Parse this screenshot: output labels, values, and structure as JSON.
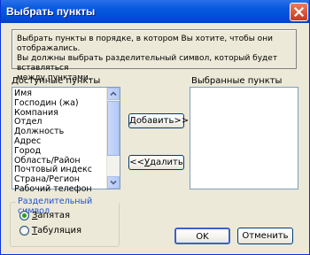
{
  "window": {
    "title": "Выбрать пункты"
  },
  "info": {
    "line1": "Выбрать пункты в порядке, в котором Вы хотите, чтобы они отображались.",
    "line2": "Вы должны выбрать разделительный символ, который будет вставляться",
    "line3": "между пунктами."
  },
  "available": {
    "label_first": "Д",
    "label_rest": "оступные пункты",
    "items": [
      "Имя",
      "Господин (жа)",
      "Компания",
      "Отдел",
      "Должность",
      "Адрес",
      "Город",
      "Область/Район",
      "Почтовый индекс",
      "Страна/Регион",
      "Рабочий телефон"
    ]
  },
  "selected": {
    "label": "Выбранные пункты",
    "items": []
  },
  "buttons": {
    "add_first": "Д",
    "add_rest": "обавить>>",
    "remove_pre": "<<",
    "remove_first": "У",
    "remove_rest": "далить",
    "ok": "OK",
    "cancel": "Отменить"
  },
  "separator": {
    "label": "Разделительный символ",
    "options": [
      {
        "first": "З",
        "rest": "апятая",
        "selected": true
      },
      {
        "first": "Т",
        "rest": "абуляция",
        "selected": false
      }
    ]
  }
}
